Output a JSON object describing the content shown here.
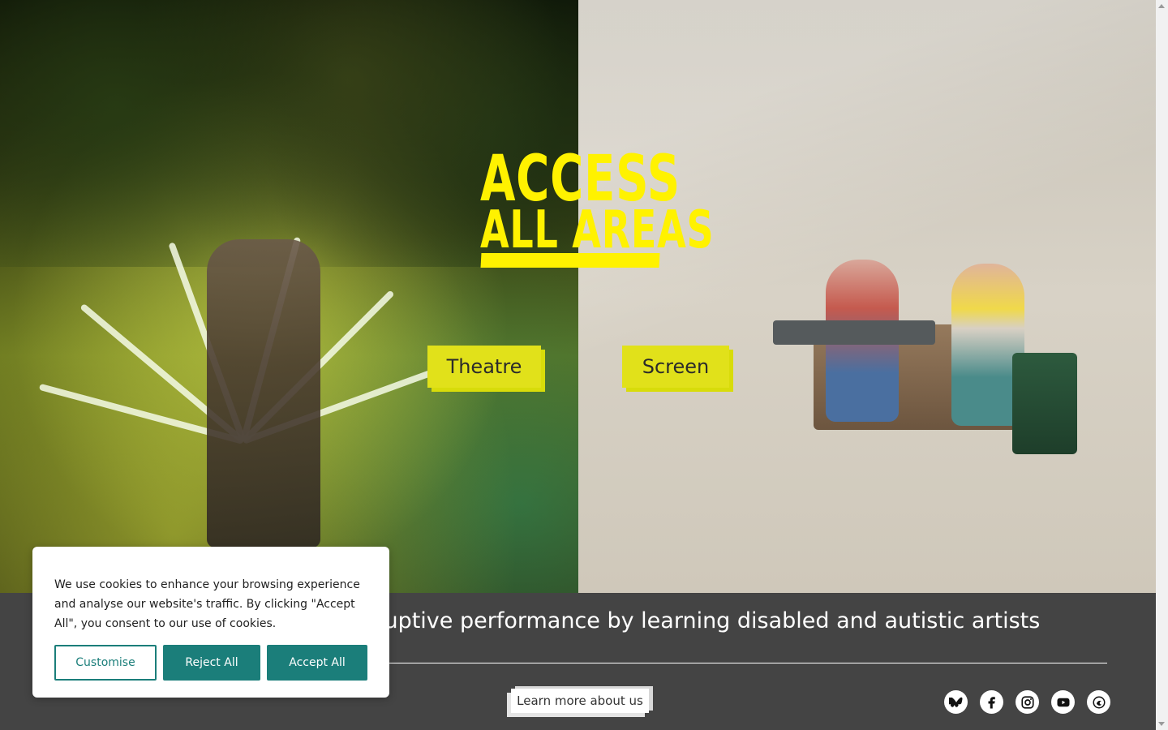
{
  "logo": {
    "line1": "ACCESS",
    "line2": "ALL AREAS"
  },
  "categories": {
    "theatre": "Theatre",
    "screen": "Screen"
  },
  "tagline": "Disruptive performance by learning disabled and autistic artists",
  "learn_more": "Learn more about us",
  "social_icons": [
    "bluesky-icon",
    "facebook-icon",
    "instagram-icon",
    "youtube-icon",
    "mailchimp-icon"
  ],
  "cookie": {
    "message": "We use cookies to enhance your browsing experience and analyse our website's traffic. By clicking \"Accept All\", you consent to our use of cookies.",
    "customise": "Customise",
    "reject": "Reject All",
    "accept": "Accept All"
  },
  "colors": {
    "brand_yellow": "#fff200",
    "button_yellow": "#e1e11a",
    "band_gray": "#444444",
    "cookie_teal": "#1b7e7a"
  }
}
